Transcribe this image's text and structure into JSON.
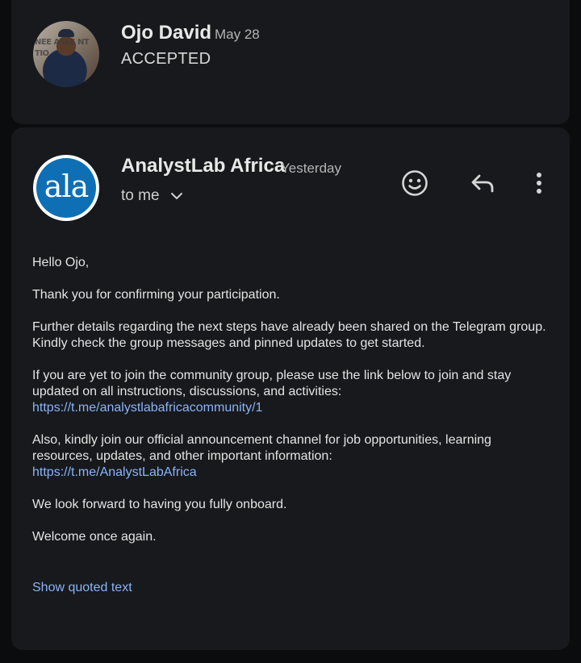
{
  "previous_message": {
    "sender": "Ojo David",
    "date": "May 28",
    "snippet": "ACCEPTED",
    "avatar_icon": "profile-photo",
    "avatar_sign_text": "NEE ASSE NT TIO"
  },
  "message": {
    "sender": "AnalystLab Africa",
    "date": "Yesterday",
    "recipient_label": "to me",
    "avatar_logo_text": "ala",
    "avatar_color": "#0f6fb5",
    "actions": {
      "react_icon": "smiley-icon",
      "reply_icon": "reply-icon",
      "more_icon": "more-vert-icon"
    },
    "body": {
      "greeting": "Hello Ojo,",
      "p1": "Thank you for confirming your participation.",
      "p2": "Further details regarding the next steps have already been shared on the Telegram group. Kindly check the group messages and pinned updates to get started.",
      "p3": "If you are yet to join the community group, please use the link below to join and stay updated on all instructions, discussions, and activities:",
      "link1": "https://t.me/analystlabafricacommunity/1",
      "p4": "Also, kindly join our official announcement channel for job opportunities, learning resources, updates, and other important information:",
      "link2": "https://t.me/AnalystLabAfrica",
      "p5": "We look forward to having you fully onboard.",
      "p6": "Welcome once again."
    },
    "show_quoted_label": "Show quoted text"
  },
  "colors": {
    "background": "#0b0c0e",
    "card": "#17191c",
    "link": "#8ab4f8"
  }
}
